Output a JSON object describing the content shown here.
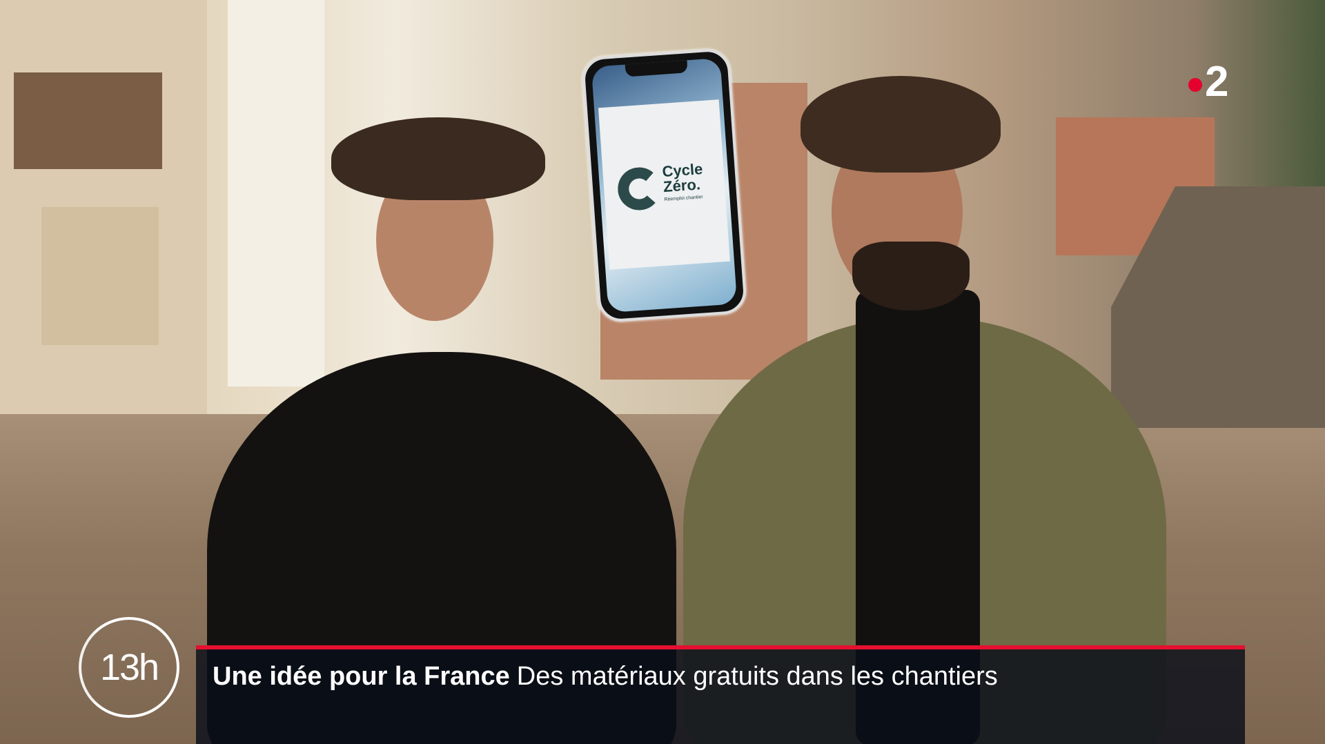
{
  "channel_logo": {
    "text": "2",
    "dot_color": "#e5002e"
  },
  "program_badge": {
    "label": "13h"
  },
  "lower_third": {
    "title": "Une idée pour la France",
    "subtitle": "Des matériaux gratuits dans les chantiers",
    "accent_color": "#e5102f"
  },
  "phone_screen": {
    "brand_line1": "Cycle",
    "brand_line2": "Zéro.",
    "tagline": "Réemploi chantier"
  }
}
